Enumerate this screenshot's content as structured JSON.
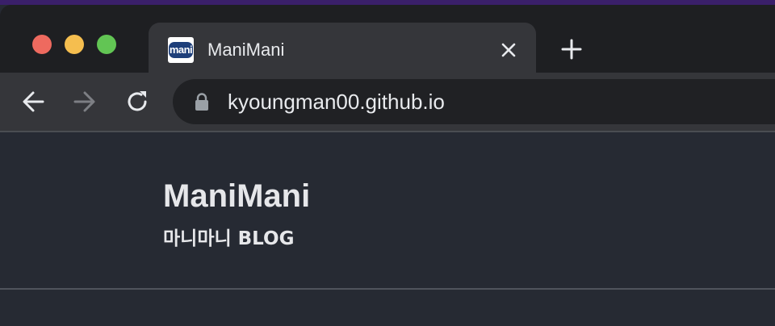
{
  "tab": {
    "favicon_text": "mani",
    "title": "ManiMani"
  },
  "address_bar": {
    "url": "kyoungman00.github.io"
  },
  "site": {
    "title": "ManiMani",
    "subtitle": "마니마니 BLOG"
  },
  "colors": {
    "page_background": "#262a33",
    "tab_strip": "#1e1f22",
    "active_tab": "#35363a",
    "omnibox": "#202124",
    "traffic_close": "#ee6a5f",
    "traffic_minimize": "#f5be4f",
    "traffic_maximize": "#62c554",
    "favicon_badge": "#1e3f7a"
  },
  "icons": {
    "back": "arrow-left-icon",
    "forward": "arrow-right-icon",
    "reload": "reload-icon",
    "lock": "lock-icon",
    "tab_close": "close-icon",
    "new_tab": "plus-icon"
  }
}
